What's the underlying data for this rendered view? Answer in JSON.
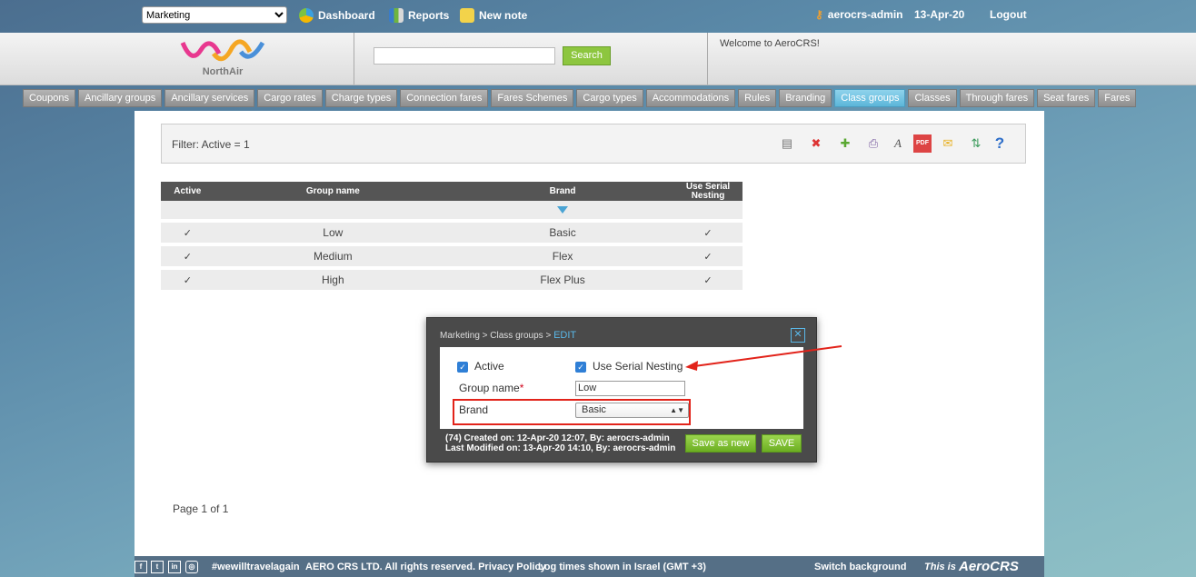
{
  "topbar": {
    "module_select": "Marketing",
    "dashboard": "Dashboard",
    "reports": "Reports",
    "new_note": "New note",
    "user": "aerocrs-admin",
    "date": "13-Apr-20",
    "logout": "Logout"
  },
  "header": {
    "logo_text": "NorthAir",
    "search_button": "Search",
    "search_placeholder": "",
    "welcome": "Welcome to AeroCRS!"
  },
  "nav": {
    "tabs": [
      "Coupons",
      "Ancillary groups",
      "Ancillary services",
      "Cargo rates",
      "Charge types",
      "Connection fares",
      "Fares Schemes",
      "Cargo types",
      "Accommodations",
      "Rules",
      "Branding",
      "Class groups",
      "Classes",
      "Through fares",
      "Seat fares",
      "Fares"
    ],
    "active": "Class groups"
  },
  "filter": {
    "text": "Filter: Active = 1"
  },
  "toolbar_icons": [
    "search-record-icon",
    "clear-filter-icon",
    "add-new-icon",
    "print-icon",
    "font-icon",
    "pdf-icon",
    "email-icon",
    "refresh-icon",
    "help-icon"
  ],
  "table": {
    "headers": [
      "Active",
      "Group name",
      "Brand",
      "Use Serial Nesting"
    ],
    "rows": [
      {
        "active": "✓",
        "group": "Low",
        "brand": "Basic",
        "serial": "✓"
      },
      {
        "active": "✓",
        "group": "Medium",
        "brand": "Flex",
        "serial": "✓"
      },
      {
        "active": "✓",
        "group": "High",
        "brand": "Flex Plus",
        "serial": "✓"
      }
    ]
  },
  "paging": {
    "text": "Page 1 of 1"
  },
  "dialog": {
    "breadcrumb": "Marketing > Class groups >",
    "mode": "EDIT",
    "active_label": "Active",
    "serial_label": "Use Serial Nesting",
    "group_name_label": "Group name",
    "group_name_required": "*",
    "group_name_value": "Low",
    "brand_label": "Brand",
    "brand_value": "Basic",
    "created": "(74) Created on: 12-Apr-20 12:07, By: aerocrs-admin",
    "modified": "Last Modified on: 13-Apr-20 14:10, By: aerocrs-admin",
    "save_as_new": "Save as new",
    "save": "SAVE"
  },
  "footer": {
    "hashtag": "#wewilltravelagain",
    "copyright": "AERO CRS LTD. All rights reserved. Privacy Policy",
    "log_times": "Log times shown in Israel (GMT +3)",
    "switch_bg": "Switch background",
    "this_is": "This is",
    "brand": "AeroCRS"
  },
  "colors": {
    "accent_green": "#8dc63f",
    "active_tab": "#5cb6d9",
    "annotation_red": "#e2231a"
  }
}
